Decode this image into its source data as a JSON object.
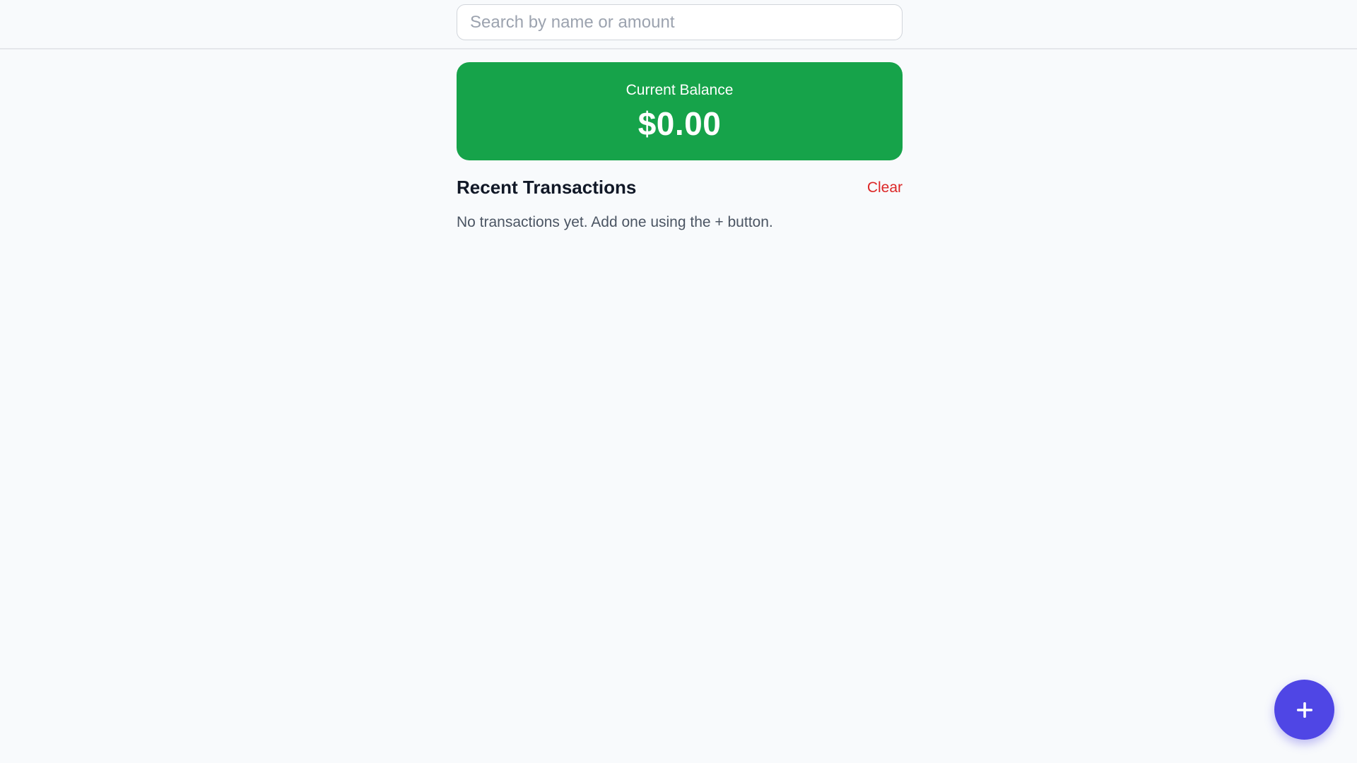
{
  "search": {
    "placeholder": "Search by name or amount",
    "value": ""
  },
  "balance": {
    "label": "Current Balance",
    "amount": "$0.00",
    "card_color": "#16a34a"
  },
  "transactions": {
    "title": "Recent Transactions",
    "clear_label": "Clear",
    "empty_message": "No transactions yet. Add one using the + button.",
    "items": []
  },
  "fab": {
    "icon": "plus-icon",
    "color": "#4f46e5"
  },
  "colors": {
    "accent": "#4f46e5",
    "positive": "#16a34a",
    "danger": "#dc2626",
    "background": "#f8fafc"
  }
}
